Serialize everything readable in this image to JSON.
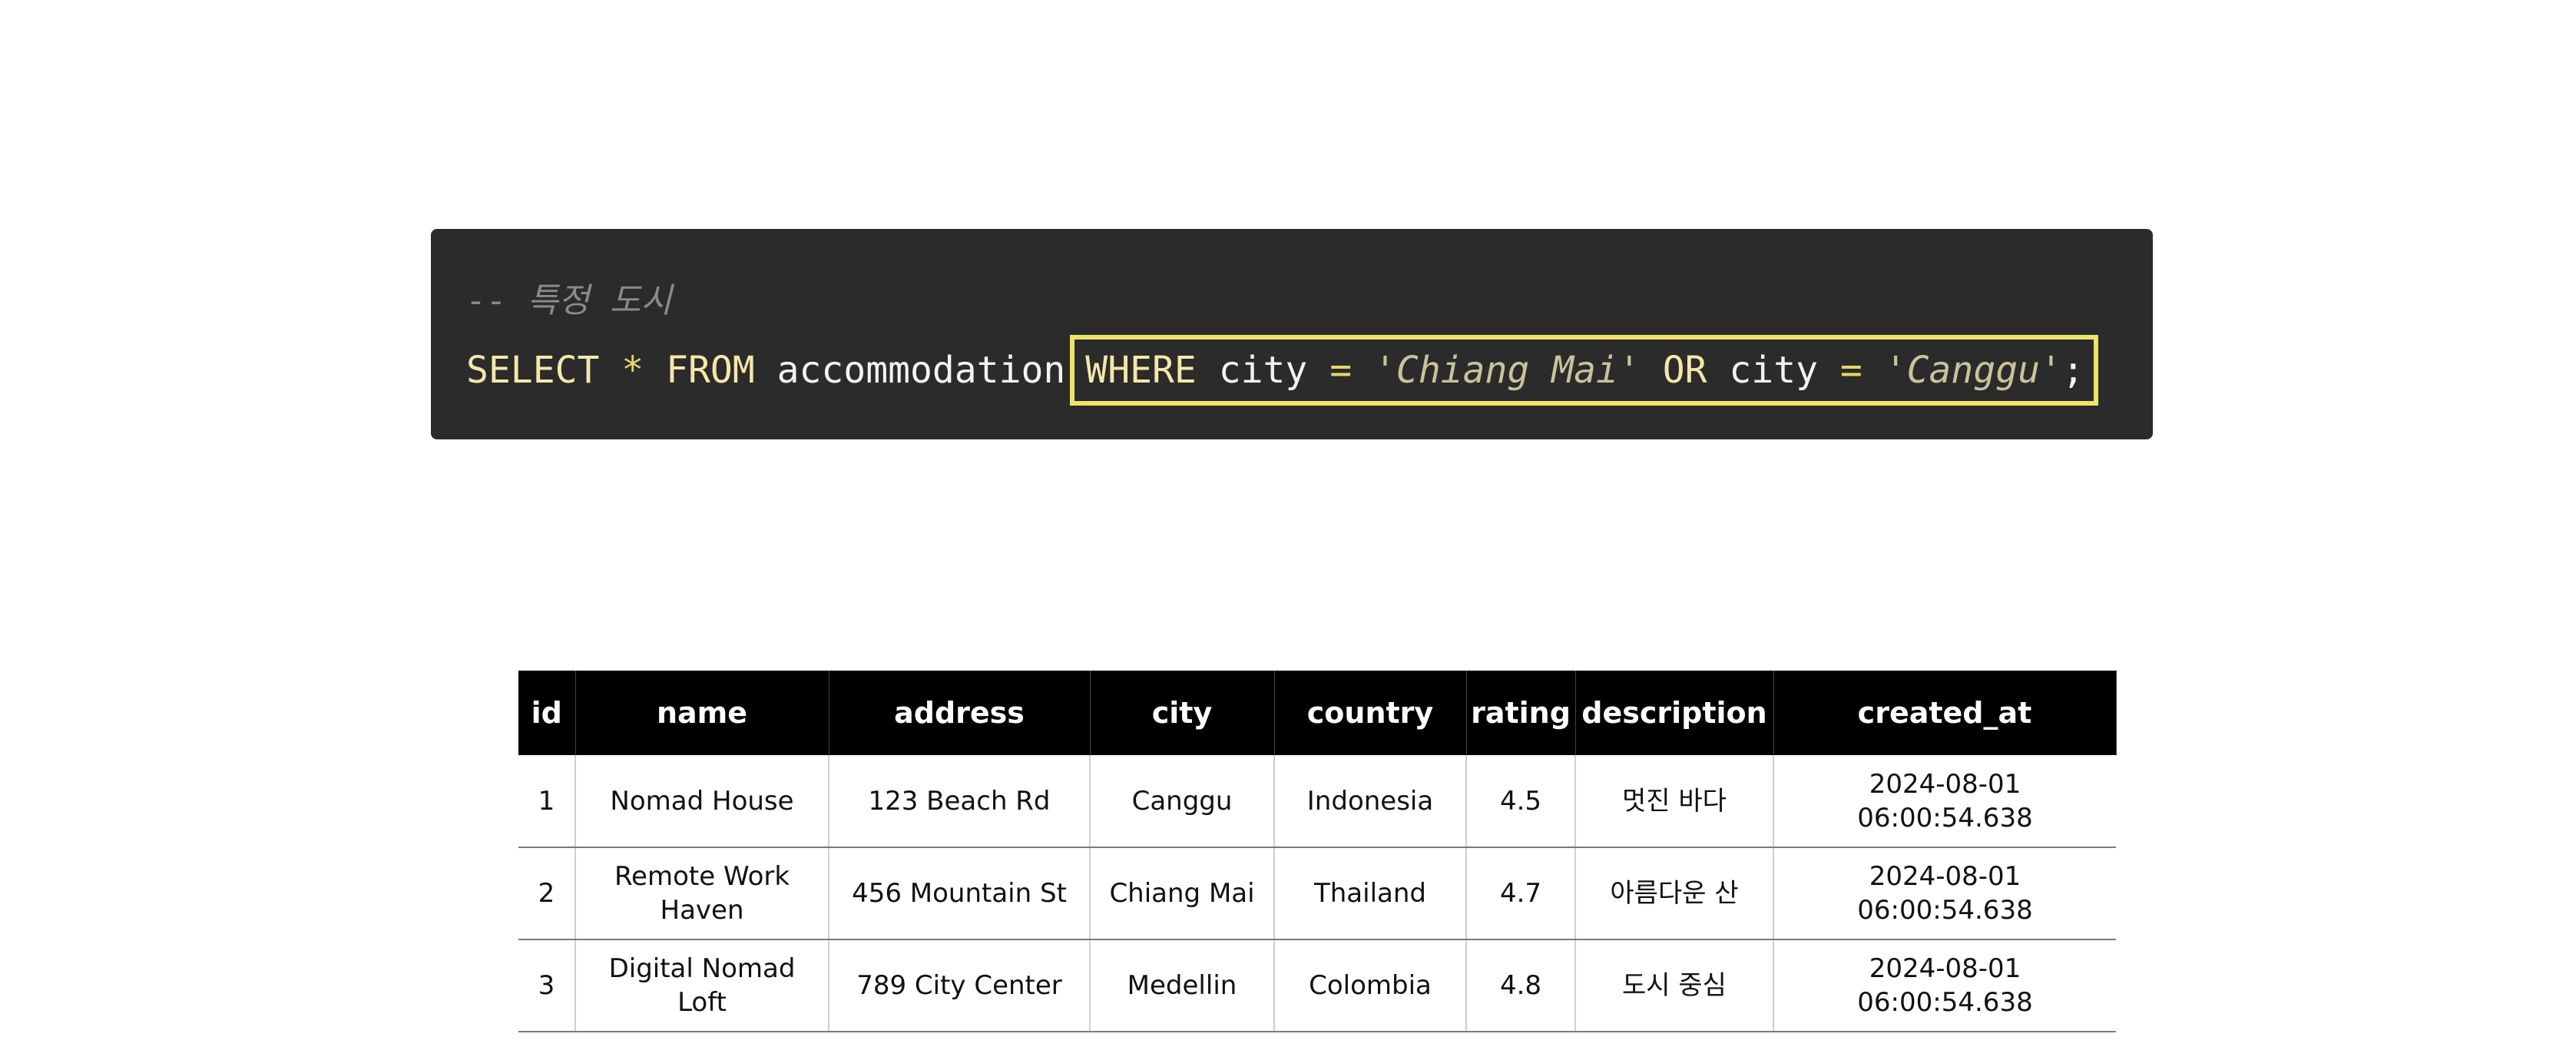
{
  "code": {
    "comment": "-- 특정 도시",
    "tokens": {
      "select": "SELECT",
      "star": "*",
      "from": "FROM",
      "table": "accommodation",
      "where": "WHERE",
      "col1": "city",
      "eq1": "=",
      "val1": "'Chiang Mai'",
      "or": "OR",
      "col2": "city",
      "eq2": "=",
      "val2": "'Canggu'",
      "semi": ";"
    },
    "colors": {
      "background": "#2b2b2b",
      "highlight": "#f0e468"
    }
  },
  "table": {
    "headers": [
      "id",
      "name",
      "address",
      "city",
      "country",
      "rating",
      "description",
      "created_at"
    ],
    "rows": [
      [
        "1",
        "Nomad House",
        "123 Beach Rd",
        "Canggu",
        "Indonesia",
        "4.5",
        "멋진 바다",
        "2024-08-01 06:00:54.638"
      ],
      [
        "2",
        "Remote Work Haven",
        "456 Mountain St",
        "Chiang Mai",
        "Thailand",
        "4.7",
        "아름다운 산",
        "2024-08-01 06:00:54.638"
      ],
      [
        "3",
        "Digital Nomad Loft",
        "789 City Center",
        "Medellin",
        "Colombia",
        "4.8",
        "도시 중심",
        "2024-08-01 06:00:54.638"
      ]
    ]
  }
}
